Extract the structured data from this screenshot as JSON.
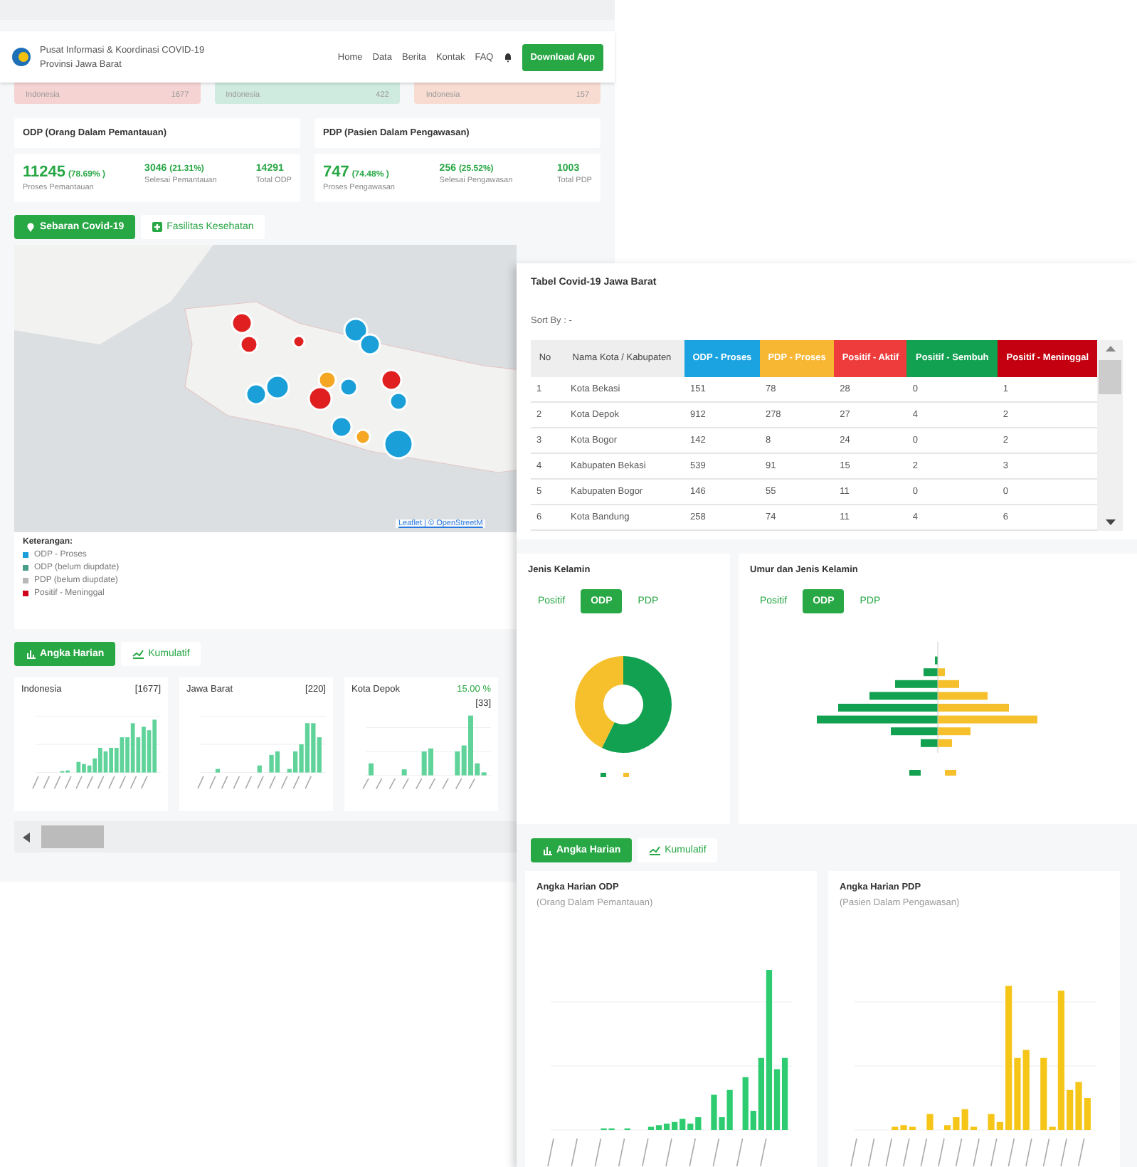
{
  "left_page": {
    "header": {
      "title_lines": [
        "Pusat Informasi & Koordinasi COVID-19",
        "Provinsi Jawa Barat"
      ],
      "nav": [
        "Home",
        "Data",
        "Berita",
        "Kontak",
        "FAQ"
      ],
      "button": "Download App"
    },
    "summary_cards": [
      {
        "label": "Indonesia",
        "value": "1677",
        "color": "#f6d3d3"
      },
      {
        "label": "Indonesia",
        "value": "422",
        "color": "#cfeadf"
      },
      {
        "label": "Indonesia",
        "value": "157",
        "color": "#f8dcd2"
      }
    ],
    "stat_cards": [
      {
        "title": "ODP (Orang Dalam Pemantauan)",
        "stats": [
          {
            "value": "11245",
            "percent": "(78.69% )",
            "label": "Proses Pemantauan"
          },
          {
            "value": "3046",
            "percent": "(21.31%)",
            "label": "Selesai Pemantauan"
          },
          {
            "value": "14291",
            "label": "Total ODP"
          }
        ]
      },
      {
        "title": "PDP (Pasien Dalam Pengawasan)",
        "stats": [
          {
            "value": "747",
            "percent": "(74.48% )",
            "label": "Proses Pengawasan"
          },
          {
            "value": "256",
            "percent": "(25.52%)",
            "label": "Selesai Pengawasan"
          },
          {
            "value": "1003",
            "label": "Total PDP"
          }
        ]
      }
    ],
    "map_tabs": [
      {
        "label": "Sebaran Covid-19",
        "selected": true
      },
      {
        "label": "Fasilitas Kesehatan",
        "selected": false
      }
    ],
    "map": {
      "attribution": "Leaflet | © OpenStreetM"
    },
    "legend": {
      "title": "Keterangan:",
      "items": [
        {
          "label": "ODP - Proses",
          "color": "#1a9fd8"
        },
        {
          "label": "ODP (belum diupdate)",
          "color": "#4a9c8c"
        },
        {
          "label": "PDP (belum diupdate)",
          "color": "#b8b8b8"
        },
        {
          "label": "Positif - Meninggal",
          "color": "#d0021b"
        }
      ]
    },
    "daily_tabs": [
      {
        "label": "Angka Harian",
        "selected": true
      },
      {
        "label": "Kumulatif",
        "selected": false
      }
    ],
    "daily_cards": [
      {
        "name": "Indonesia",
        "value": "[1677]"
      },
      {
        "name": "Jawa Barat",
        "value": "[220]"
      },
      {
        "name": "Kota Depok",
        "percent": "15.00 %",
        "value": "[33]"
      }
    ]
  },
  "right_page": {
    "table": {
      "title": "Tabel Covid-19 Jawa Barat",
      "sort_label": "Sort By : -",
      "columns": [
        {
          "label": "No",
          "color": "#eeeeee"
        },
        {
          "label": "Nama Kota / Kabupaten",
          "color": "#eeeeee"
        },
        {
          "label": "ODP - Proses",
          "color": "#1aa3e0"
        },
        {
          "label": "PDP - Proses",
          "color": "#f7b733"
        },
        {
          "label": "Positif - Aktif",
          "color": "#ee3b3b"
        },
        {
          "label": "Positif - Sembuh",
          "color": "#12a150"
        },
        {
          "label": "Positif - Meninggal",
          "color": "#c40010"
        }
      ],
      "rows": [
        [
          "1",
          "Kota Bekasi",
          "151",
          "78",
          "28",
          "0",
          "1"
        ],
        [
          "2",
          "Kota Depok",
          "912",
          "278",
          "27",
          "4",
          "2"
        ],
        [
          "3",
          "Kota Bogor",
          "142",
          "8",
          "24",
          "0",
          "2"
        ],
        [
          "4",
          "Kabupaten Bekasi",
          "539",
          "91",
          "15",
          "2",
          "3"
        ],
        [
          "5",
          "Kabupaten Bogor",
          "146",
          "55",
          "11",
          "0",
          "0"
        ],
        [
          "6",
          "Kota Bandung",
          "258",
          "74",
          "11",
          "4",
          "6"
        ]
      ]
    },
    "gender_card": {
      "title": "Jenis Kelamin",
      "tabs": [
        {
          "label": "Positif",
          "selected": false
        },
        {
          "label": "ODP",
          "selected": true
        },
        {
          "label": "PDP",
          "selected": false
        }
      ]
    },
    "age_card": {
      "title": "Umur dan Jenis Kelamin",
      "tabs": [
        {
          "label": "Positif",
          "selected": false
        },
        {
          "label": "ODP",
          "selected": true
        },
        {
          "label": "PDP",
          "selected": false
        }
      ]
    },
    "daily_tabs": [
      {
        "label": "Angka Harian",
        "selected": true
      },
      {
        "label": "Kumulatif",
        "selected": false
      }
    ],
    "daily_charts": [
      {
        "title": "Angka Harian ODP",
        "subtitle": "(Orang Dalam Pemantauan)",
        "color": "#2ecc71"
      },
      {
        "title": "Angka Harian PDP",
        "subtitle": "(Pasien Dalam Pengawasan)",
        "color": "#f5c518"
      }
    ]
  }
}
